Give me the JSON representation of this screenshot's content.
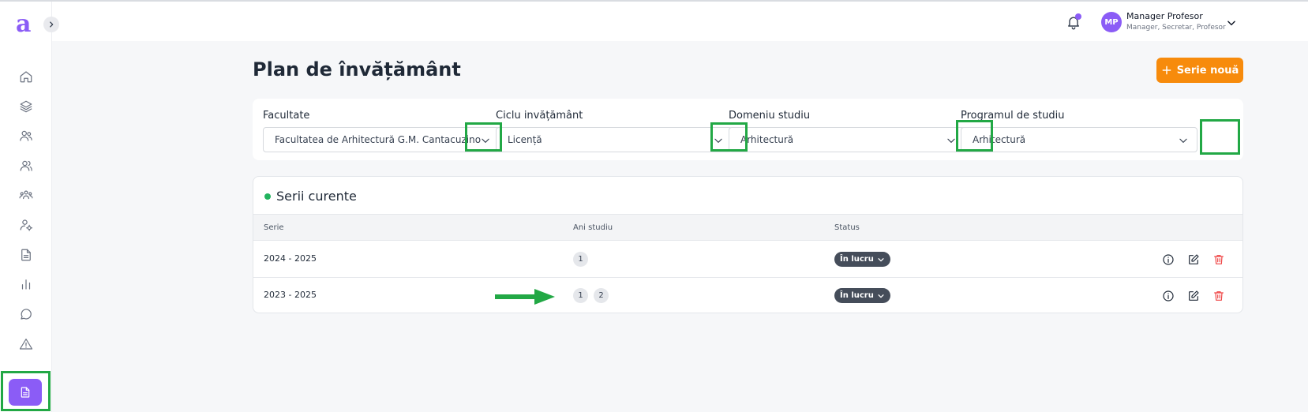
{
  "app": {
    "logo_letter": "a"
  },
  "sidebar": {
    "items": [
      {
        "icon": "home-icon"
      },
      {
        "icon": "layers-icon"
      },
      {
        "icon": "users-icon"
      },
      {
        "icon": "user-group-icon"
      },
      {
        "icon": "team-icon"
      },
      {
        "icon": "user-settings-icon"
      },
      {
        "icon": "document-icon"
      },
      {
        "icon": "bar-chart-icon"
      },
      {
        "icon": "chat-icon"
      },
      {
        "icon": "warning-icon"
      }
    ],
    "active_icon": "document-icon"
  },
  "header": {
    "avatar_initials": "MP",
    "user_name": "Manager Profesor",
    "user_roles": "Manager, Secretar, Profesor"
  },
  "page": {
    "title": "Plan de învățământ",
    "new_button_label": "Serie nouă"
  },
  "filters": [
    {
      "label": "Facultate",
      "value": "Facultatea de Arhitectură G.M. Cantacuzino"
    },
    {
      "label": "Ciclu invățământ",
      "value": "Licență"
    },
    {
      "label": "Domeniu studiu",
      "value": "Arhitectură"
    },
    {
      "label": "Programul de studiu",
      "value": "Arhitectură"
    }
  ],
  "series": {
    "title": "Serii curente",
    "columns": [
      "Serie",
      "Ani studiu",
      "Status"
    ],
    "rows": [
      {
        "serie": "2024 - 2025",
        "years": [
          "1"
        ],
        "status": "În lucru"
      },
      {
        "serie": "2023 - 2025",
        "years": [
          "1",
          "2"
        ],
        "status": "În lucru"
      }
    ]
  },
  "colors": {
    "accent": "#8b5cf6",
    "primary_button": "#f78b0c",
    "highlight": "#22a845",
    "status_dot": "#22b35e",
    "delete": "#ef4444"
  }
}
